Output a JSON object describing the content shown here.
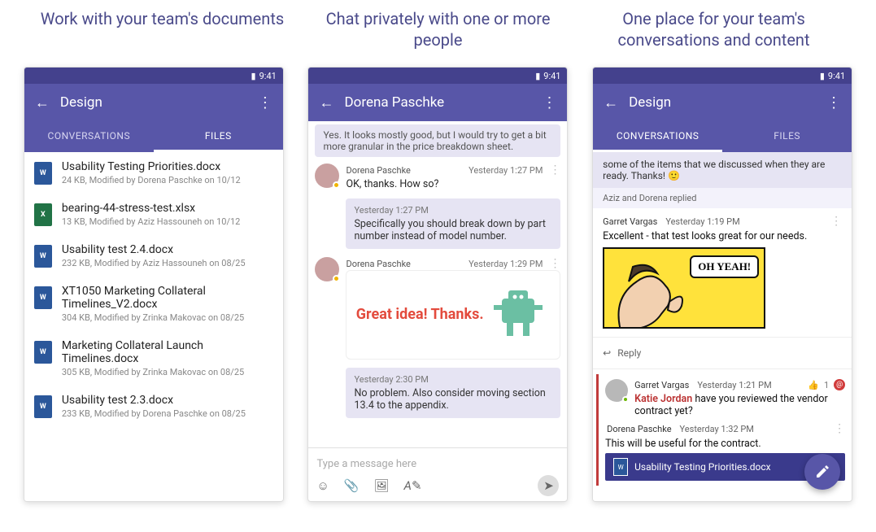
{
  "statusbar_time": "9:41",
  "captions": [
    "Work with your team's documents",
    "Chat privately with one or more people",
    "One place for your team's conversations and content"
  ],
  "panel1": {
    "title": "Design",
    "tabs": {
      "conversations": "CONVERSATIONS",
      "files": "FILES"
    },
    "files": [
      {
        "icon": "word",
        "name": "Usability Testing Priorities.docx",
        "meta": "24 KB, Modified by Dorena Paschke on 10/12"
      },
      {
        "icon": "excel",
        "name": "bearing-44-stress-test.xlsx",
        "meta": "13 KB, Modified by Aziz Hassouneh on 10/12"
      },
      {
        "icon": "word",
        "name": "Usability test 2.4.docx",
        "meta": "232 KB, Modified by Aziz Hassouneh on 08/25"
      },
      {
        "icon": "word",
        "name": "XT1050 Marketing Collateral Timelines_V2.docx",
        "meta": "304 KB, Modified by Zrinka Makovac on 08/25"
      },
      {
        "icon": "word",
        "name": "Marketing Collateral Launch Timelines.docx",
        "meta": "305 KB, Modified by Zrinka Makovac on 08/25"
      },
      {
        "icon": "word",
        "name": "Usability test 2.3.docx",
        "meta": "233 KB, Modified by Dorena Paschke on 08/25"
      }
    ]
  },
  "panel2": {
    "title": "Dorena Paschke",
    "partial_top": "Yes. It looks mostly good, but I would try to get a bit more granular in the price breakdown sheet.",
    "m1": {
      "name": "Dorena Paschke",
      "ts": "Yesterday 1:27 PM",
      "body": "OK, thanks. How so?"
    },
    "m2": {
      "ts": "Yesterday 1:27 PM",
      "body": "Specifically you should break down by part number instead of model number."
    },
    "m3": {
      "name": "Dorena Paschke",
      "ts": "Yesterday 1:29 PM",
      "sticker_text": "Great idea! Thanks."
    },
    "m4": {
      "ts": "Yesterday 2:30 PM",
      "body": "No problem. Also consider moving section 13.4 to the appendix."
    },
    "compose_placeholder": "Type a message here"
  },
  "panel3": {
    "title": "Design",
    "tabs": {
      "conversations": "CONVERSATIONS",
      "files": "FILES"
    },
    "quoted": "some of the items that we discussed when they are ready. Thanks! 🙂",
    "replies_line": "Aziz and Dorena replied",
    "post1": {
      "author": "Garret Vargas",
      "ts": "Yesterday 1:19 PM",
      "body": "Excellent - that test looks great for our needs.",
      "ohyeah": "OH YEAH!"
    },
    "reply_label": "Reply",
    "thread": {
      "row1_author": "Garret Vargas",
      "row1_ts": "Yesterday 1:21 PM",
      "row1_like": "1",
      "row1_mention": "Katie Jordan",
      "row1_rest": " have you reviewed the vendor contract yet?",
      "row2_author": "Dorena Paschke",
      "row2_ts": "Yesterday 1:32 PM",
      "row2_body": "This will be useful for the contract.",
      "attach_name": "Usability Testing Priorities.docx"
    }
  }
}
